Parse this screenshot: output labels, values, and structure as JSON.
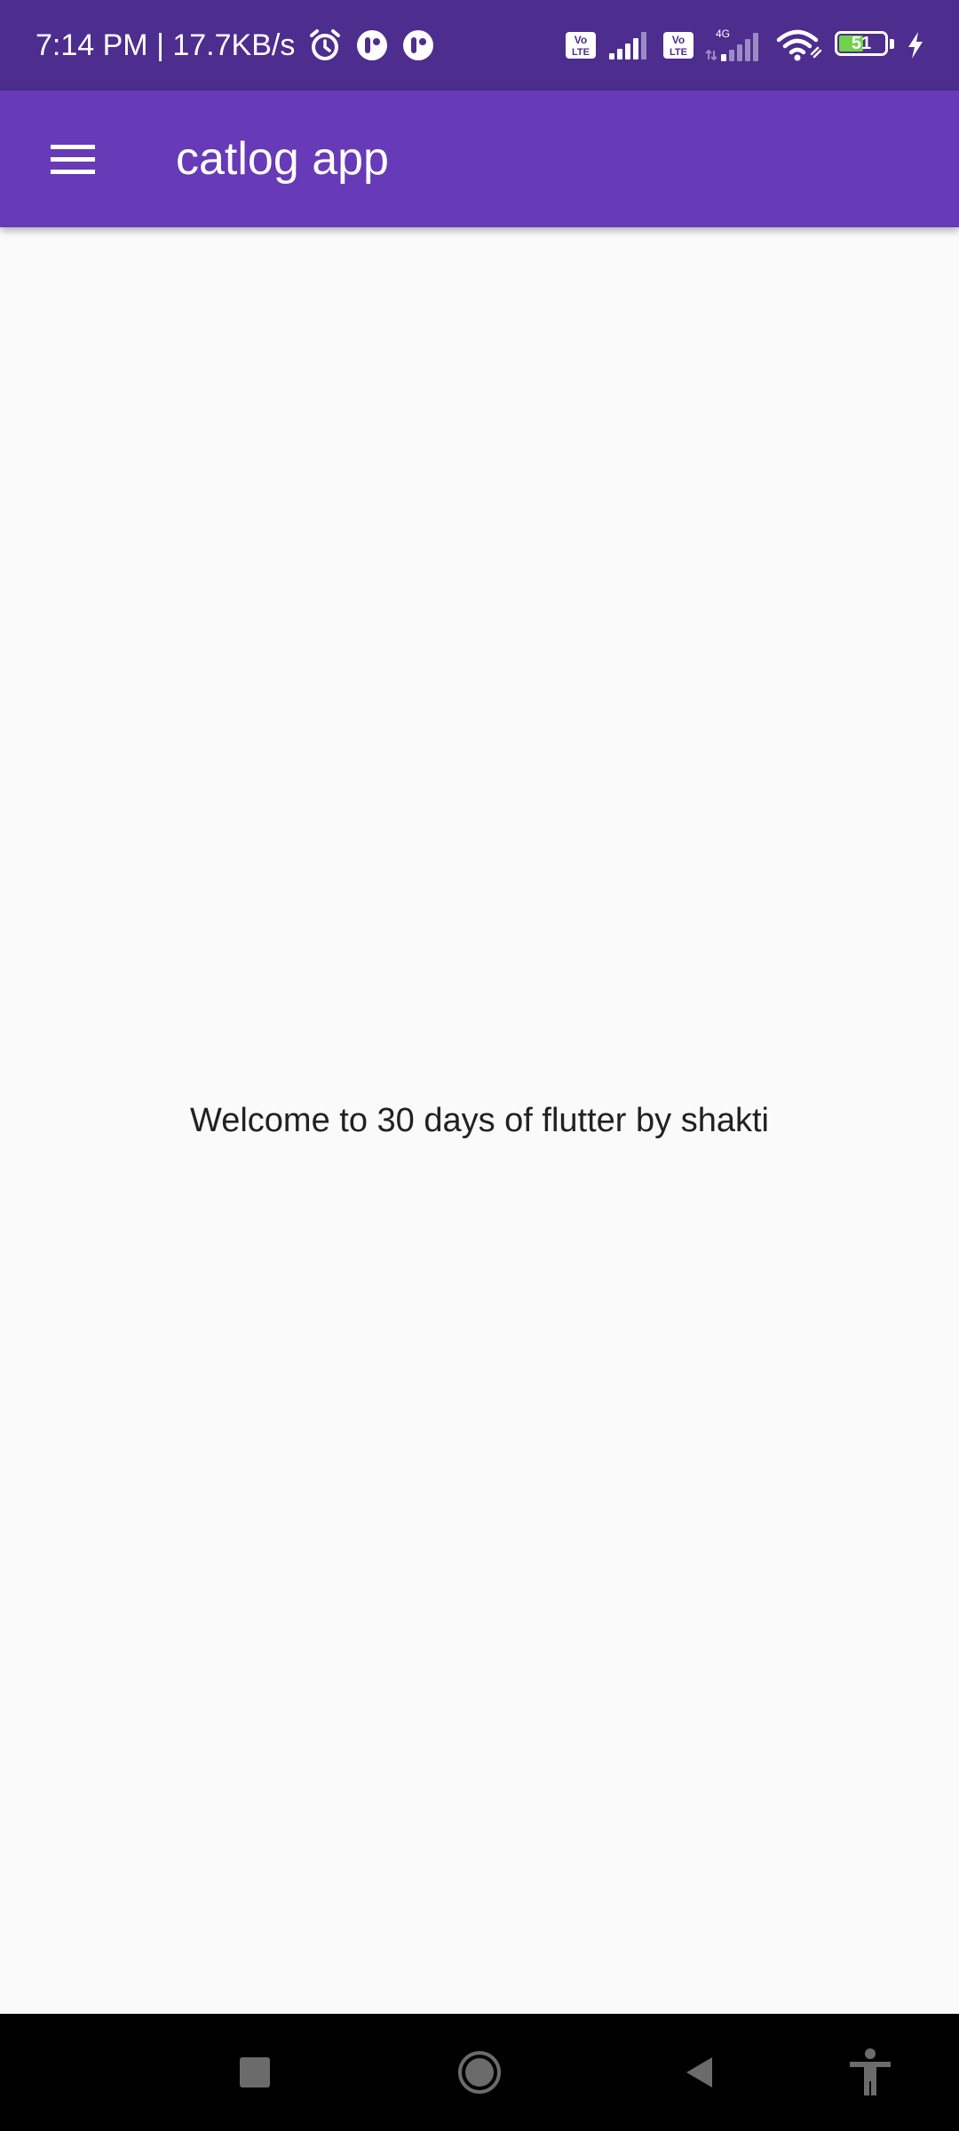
{
  "status_bar": {
    "time_speed": "7:14 PM | 17.7KB/s",
    "network_label": "4G",
    "volte_label": "Vo\nLTE",
    "battery_level": "51",
    "icons": [
      "alarm-icon",
      "app-notification-icon",
      "app-notification-icon",
      "volte-icon",
      "signal-icon",
      "volte-icon",
      "signal-4g-icon",
      "wifi-icon",
      "battery-icon",
      "charging-icon"
    ]
  },
  "app_bar": {
    "title": "catlog app",
    "menu_icon": "hamburger-menu-icon",
    "background_color": "#673ab7"
  },
  "body": {
    "welcome_text": "Welcome to 30 days of flutter by shakti"
  },
  "nav_bar": {
    "buttons": [
      "recents-button",
      "home-button",
      "back-button",
      "accessibility-button"
    ]
  },
  "colors": {
    "status_bar": "#4d2d8e",
    "app_bar": "#673ab7",
    "background": "#fafafa",
    "text": "#212121"
  }
}
